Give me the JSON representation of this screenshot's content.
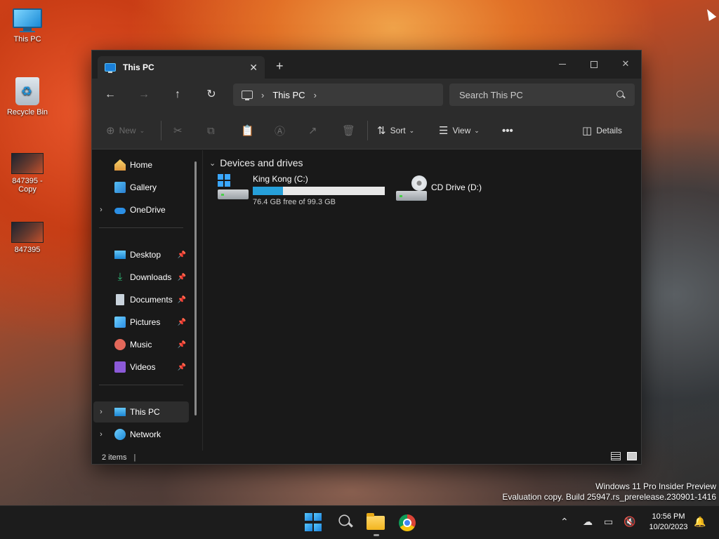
{
  "desktop": {
    "icons": [
      {
        "label": "This PC"
      },
      {
        "label": "Recycle Bin"
      },
      {
        "label": "847395 - Copy"
      },
      {
        "label": "847395"
      }
    ]
  },
  "window": {
    "tab_title": "This PC",
    "nav": {
      "address_crumb": "This PC",
      "search_placeholder": "Search This PC"
    },
    "toolbar": {
      "new_label": "New",
      "sort_label": "Sort",
      "view_label": "View",
      "details_label": "Details"
    },
    "sidebar": {
      "items": [
        {
          "label": "Home",
          "icon": "home-icon"
        },
        {
          "label": "Gallery",
          "icon": "gallery-icon"
        },
        {
          "label": "OneDrive",
          "icon": "onedrive-icon"
        },
        {
          "label": "Desktop",
          "icon": "desktop-folder-icon",
          "pinned": true
        },
        {
          "label": "Downloads",
          "icon": "downloads-icon",
          "pinned": true
        },
        {
          "label": "Documents",
          "icon": "documents-icon",
          "pinned": true
        },
        {
          "label": "Pictures",
          "icon": "pictures-icon",
          "pinned": true
        },
        {
          "label": "Music",
          "icon": "music-icon",
          "pinned": true
        },
        {
          "label": "Videos",
          "icon": "videos-icon",
          "pinned": true
        },
        {
          "label": "This PC",
          "icon": "this-pc-icon",
          "selected": true
        },
        {
          "label": "Network",
          "icon": "network-icon"
        }
      ]
    },
    "content": {
      "group_title": "Devices and drives",
      "drives": [
        {
          "name": "King Kong (C:)",
          "free_text": "76.4 GB free of 99.3 GB",
          "used_fraction": 0.23
        },
        {
          "name": "CD Drive (D:)"
        }
      ]
    },
    "status": {
      "items_text": "2 items",
      "cursor_mark": "|"
    }
  },
  "watermark": {
    "line1": "Windows 11 Pro Insider Preview",
    "line2": "Evaluation copy. Build 25947.rs_prerelease.230901-1416"
  },
  "taskbar": {
    "time": "10:56 PM",
    "date": "10/20/2023"
  },
  "colors": {
    "accent": "#26a0da",
    "window_bg": "#191919",
    "toolbar_bg": "#2c2c2c"
  }
}
